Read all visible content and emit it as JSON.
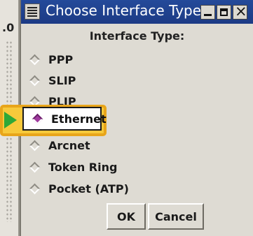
{
  "background_window": {
    "fragment_text": ".0"
  },
  "dialog": {
    "title": "Choose Interface Type",
    "header": "Interface Type:",
    "options": [
      {
        "label": "PPP",
        "selected": false
      },
      {
        "label": "SLIP",
        "selected": false
      },
      {
        "label": "PLIP",
        "selected": false
      },
      {
        "label": "Ethernet",
        "selected": true
      },
      {
        "label": "Arcnet",
        "selected": false
      },
      {
        "label": "Token Ring",
        "selected": false
      },
      {
        "label": "Pocket (ATP)",
        "selected": false
      }
    ],
    "buttons": {
      "ok": "OK",
      "cancel": "Cancel"
    }
  },
  "colors": {
    "titlebar": "#1c3a84",
    "highlight": "#f7c93b",
    "arrow": "#2fa838",
    "radio_selected": "#a03b9f"
  },
  "icons": [
    "window-menu-icon",
    "minimize-icon",
    "maximize-icon",
    "close-icon",
    "pointer-arrow-icon"
  ]
}
